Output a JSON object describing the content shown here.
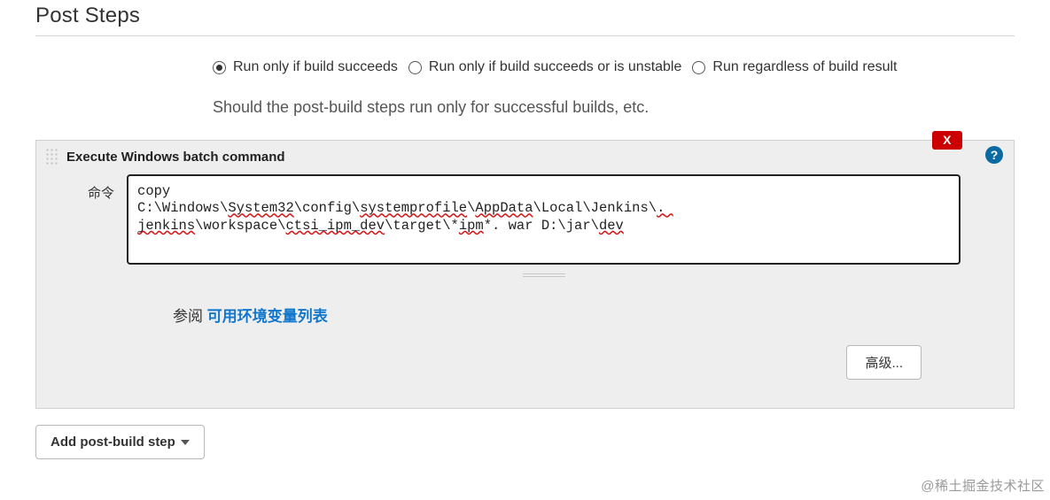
{
  "section": {
    "title": "Post Steps"
  },
  "runWhen": {
    "options": [
      {
        "label": "Run only if build succeeds",
        "selected": true
      },
      {
        "label": "Run only if build succeeds or is unstable",
        "selected": false
      },
      {
        "label": "Run regardless of build result",
        "selected": false
      }
    ],
    "description": "Should the post-build steps run only for successful builds, etc."
  },
  "step": {
    "title": "Execute Windows batch command",
    "deleteLabel": "X",
    "helpGlyph": "?",
    "commandLabel": "命令",
    "commandSegments": [
      {
        "t": "copy\n",
        "e": false
      },
      {
        "t": "C:\\Windows\\",
        "e": false
      },
      {
        "t": "System32",
        "e": true
      },
      {
        "t": "\\config\\",
        "e": false
      },
      {
        "t": "systemprofile",
        "e": true
      },
      {
        "t": "\\",
        "e": false
      },
      {
        "t": "AppData",
        "e": true
      },
      {
        "t": "\\Local\\Jenkins\\",
        "e": false
      },
      {
        "t": ". jenkins",
        "e": true
      },
      {
        "t": "\\workspace\\",
        "e": false
      },
      {
        "t": "ctsi_ipm_dev",
        "e": true
      },
      {
        "t": "\\target\\*",
        "e": false
      },
      {
        "t": "ipm",
        "e": true
      },
      {
        "t": "*. war D:\\jar\\",
        "e": false
      },
      {
        "t": "dev",
        "e": true
      }
    ],
    "refPrefix": "参阅 ",
    "refLink": "可用环境变量列表",
    "advancedLabel": "高级..."
  },
  "addStepLabel": "Add post-build step",
  "watermark": "@稀土掘金技术社区"
}
